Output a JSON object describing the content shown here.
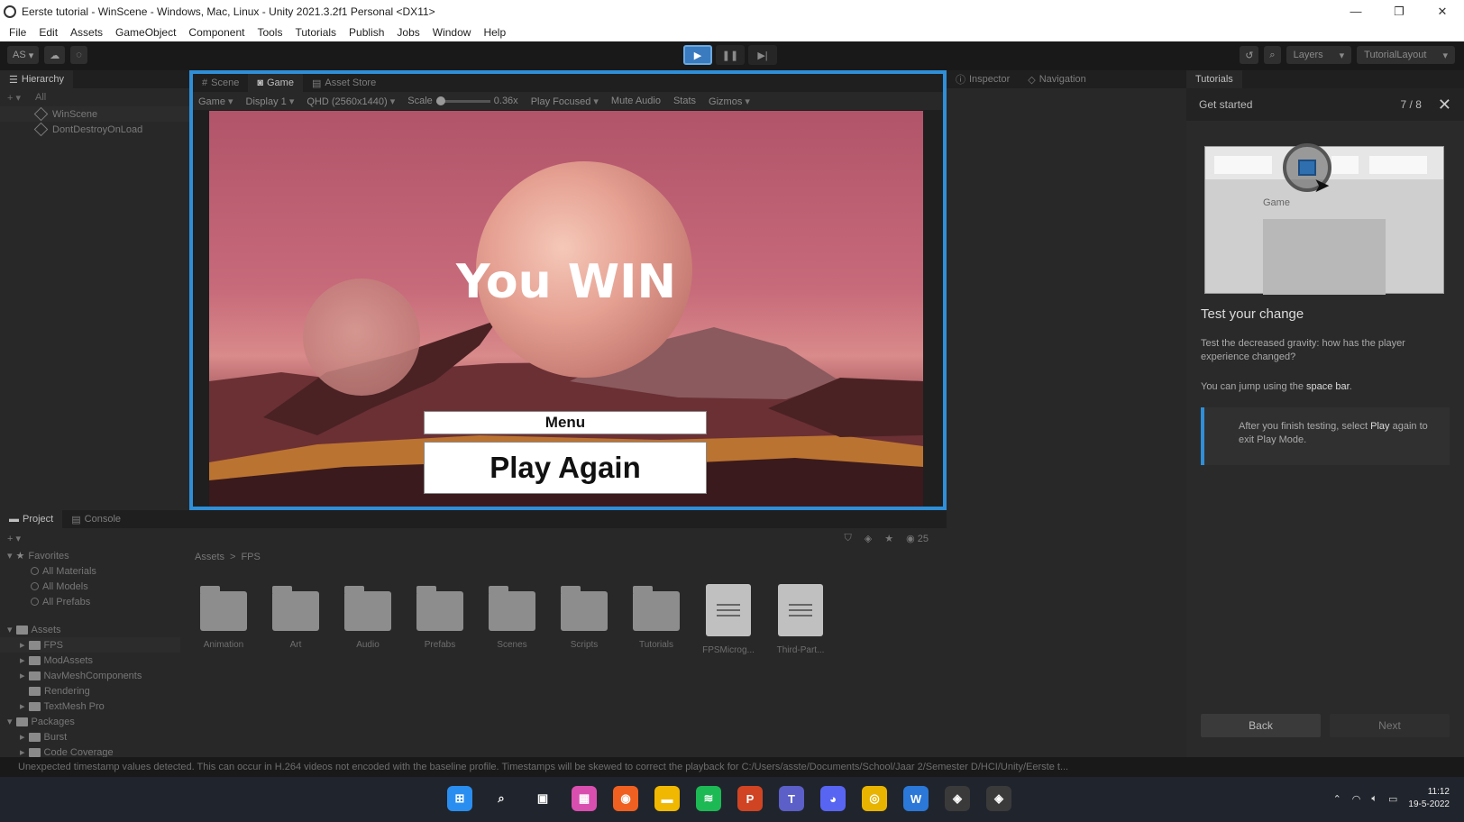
{
  "window": {
    "title": "Eerste tutorial - WinScene - Windows, Mac, Linux - Unity 2021.3.2f1 Personal <DX11>",
    "controls": [
      "—",
      "❐",
      "✕"
    ]
  },
  "menu": [
    "File",
    "Edit",
    "Assets",
    "GameObject",
    "Component",
    "Tools",
    "Tutorials",
    "Publish",
    "Jobs",
    "Window",
    "Help"
  ],
  "toolbar": {
    "account": "AS",
    "play": "▶",
    "pause": "❚❚",
    "step": "▶|",
    "layers": "Layers",
    "layout": "TutorialLayout"
  },
  "hierarchy": {
    "tab": "Hierarchy",
    "search": "All",
    "items": [
      "WinScene",
      "DontDestroyOnLoad"
    ]
  },
  "game_view": {
    "tabs": [
      "Scene",
      "Game",
      "Asset Store"
    ],
    "display_mode": "Game",
    "display": "Display 1",
    "resolution": "QHD (2560x1440)",
    "scale_label": "Scale",
    "scale_value": "0.36x",
    "play_focused": "Play Focused",
    "mute_audio": "Mute Audio",
    "stats": "Stats",
    "gizmos": "Gizmos",
    "win_text": "You WIN",
    "menu_button": "Menu",
    "play_again_button": "Play Again"
  },
  "inspector": {
    "tabs": [
      "Inspector",
      "Navigation"
    ]
  },
  "tutorials": {
    "tab": "Tutorials",
    "header": "Get started",
    "progress": "7 / 8",
    "image_label": "Game",
    "heading": "Test your change",
    "para1": "Test the decreased gravity: how has the player experience changed?",
    "para2_prefix": "You can jump using the ",
    "para2_bold": "space bar",
    "para2_suffix": ".",
    "note_prefix": "After you finish testing, select ",
    "note_bold": "Play",
    "note_suffix": " again to exit Play Mode.",
    "back": "Back",
    "next": "Next"
  },
  "project": {
    "tabs": [
      "Project",
      "Console"
    ],
    "favorites_label": "Favorites",
    "favorites": [
      "All Materials",
      "All Models",
      "All Prefabs"
    ],
    "assets_label": "Assets",
    "asset_folders": [
      "FPS",
      "ModAssets",
      "NavMeshComponents",
      "Rendering",
      "TextMesh Pro"
    ],
    "packages_label": "Packages",
    "packages": [
      "Burst",
      "Code Coverage"
    ],
    "breadcrumb": [
      "Assets",
      "FPS"
    ],
    "count": "25",
    "grid": [
      {
        "label": "Animation",
        "kind": "folder"
      },
      {
        "label": "Art",
        "kind": "folder"
      },
      {
        "label": "Audio",
        "kind": "folder"
      },
      {
        "label": "Prefabs",
        "kind": "folder"
      },
      {
        "label": "Scenes",
        "kind": "folder"
      },
      {
        "label": "Scripts",
        "kind": "folder"
      },
      {
        "label": "Tutorials",
        "kind": "folder"
      },
      {
        "label": "FPSMicrog...",
        "kind": "file"
      },
      {
        "label": "Third-Part...",
        "kind": "file"
      }
    ]
  },
  "status": {
    "message": "Unexpected timestamp values detected. This can occur in H.264 videos not encoded with the baseline profile. Timestamps will be skewed to correct the playback for C:/Users/asste/Documents/School/Jaar 2/Semester D/HCI/Unity/Eerste t..."
  },
  "taskbar": {
    "apps": [
      {
        "name": "windows-start-icon",
        "glyph": "⊞",
        "color": "#2a8ef0"
      },
      {
        "name": "search-icon",
        "glyph": "⌕",
        "color": "#20242c"
      },
      {
        "name": "task-view-icon",
        "glyph": "▣",
        "color": "#20242c"
      },
      {
        "name": "photos-icon",
        "glyph": "▦",
        "color": "#d94fb0"
      },
      {
        "name": "origin-icon",
        "glyph": "◉",
        "color": "#f06020"
      },
      {
        "name": "file-explorer-icon",
        "glyph": "▬",
        "color": "#f0b800"
      },
      {
        "name": "spotify-icon",
        "glyph": "≋",
        "color": "#1db954"
      },
      {
        "name": "powerpoint-icon",
        "glyph": "P",
        "color": "#d04423"
      },
      {
        "name": "teams-icon",
        "glyph": "T",
        "color": "#5b5fc7"
      },
      {
        "name": "discord-icon",
        "glyph": "◕",
        "color": "#5865f2"
      },
      {
        "name": "chrome-icon",
        "glyph": "◎",
        "color": "#e8b400"
      },
      {
        "name": "word-icon",
        "glyph": "W",
        "color": "#2b78d8"
      },
      {
        "name": "unity-hub-icon",
        "glyph": "◈",
        "color": "#3a3a3a"
      },
      {
        "name": "unity-editor-icon",
        "glyph": "◈",
        "color": "#3a3a3a"
      }
    ],
    "time": "11:12",
    "date": "19-5-2022"
  },
  "colors": {
    "accent": "#2f8fd8",
    "editor_bg": "#282828"
  }
}
